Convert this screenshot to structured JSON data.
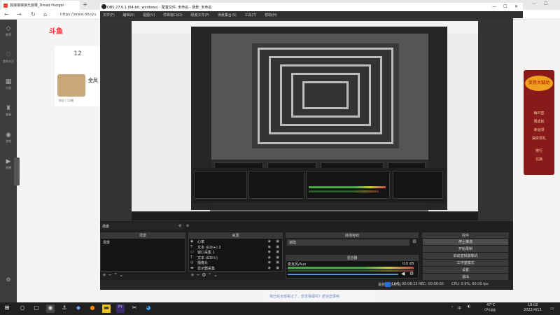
{
  "browser": {
    "tab_title": "独狼狼狼狼光莒赛_Dread Hunger",
    "url": "https://www.douyu"
  },
  "site": {
    "logo": "斗鱼",
    "left_nav": [
      "推荐",
      "我的关注",
      "分类",
      "赛事",
      "游戏",
      "直播",
      "设置"
    ],
    "card_number": "12",
    "card_name": "金凤",
    "card_stats": "粉丝 | 12播",
    "banner_title": "奖券大鼓动",
    "banner_items": [
      "每日签",
      "周成就",
      "幸运领",
      "抽奖领礼",
      "排行",
      "兑换"
    ]
  },
  "obs": {
    "title": "OBS 27.0.1 (64-bit, windows) - 配置文件: 未命名 - 场景: 未命名",
    "menu": [
      "文件(F)",
      "编辑(E)",
      "视图(V)",
      "停靠窗口(D)",
      "配置文件(P)",
      "场景集合(S)",
      "工具(T)",
      "帮助(H)"
    ],
    "scenes_header": "场景",
    "scenes": [
      "场景"
    ],
    "sources_header": "来源",
    "sources": [
      {
        "icon": "mic-icon",
        "label": "心率"
      },
      {
        "icon": "text-icon",
        "label": "文本 (GDI+) 2"
      },
      {
        "icon": "window-icon",
        "label": "窗口采集 1"
      },
      {
        "icon": "text-icon",
        "label": "文本 (GDI+)"
      },
      {
        "icon": "camera-icon",
        "label": "摄像头"
      },
      {
        "icon": "monitor-icon",
        "label": "显示器采集"
      }
    ],
    "transitions_header": "转场特效",
    "transition_value": "渐隐",
    "mixer_header": "混音器",
    "mixer_track_label": "麦克风/Aux",
    "mixer_db": "0.0 dB",
    "controls_header": "控件",
    "controls": [
      "停止推流",
      "开始录制",
      "启动虚拟摄像机",
      "工作室模式",
      "设置",
      "退出"
    ],
    "status": {
      "live": "LIVE: 00:06:15",
      "rec": "REC: 00:00:00",
      "cpu": "CPU: 0.9%, 60.00 fps",
      "dropped": "丢帧 0 (0.0%)"
    }
  },
  "danmaku_hint": "我已经全部看过了，想发弹幕吗？赶快登录吧",
  "taskbar": {
    "time": "18:02",
    "date": "2022/4/15",
    "weather": "47°C",
    "weather_sub": "CPU温度",
    "lang": "中"
  },
  "colors": {
    "obs_dark": "#1f1f1f",
    "site_accent": "#e33333",
    "banner": "#8a1a1a",
    "danmaku_text": "#6b8cc6"
  }
}
